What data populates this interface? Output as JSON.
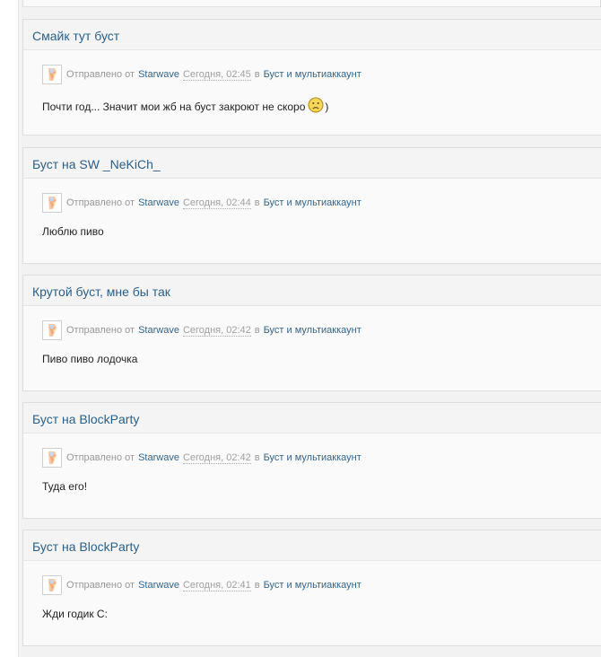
{
  "posts": [
    {
      "title": "Смайк тут буст",
      "sent_label": "Отправлено от",
      "author": "Starwave",
      "date": "Сегодня, 02:45",
      "in_label": "в",
      "forum": "Буст и мультиаккаунт",
      "body": "Почти год... Значит мои жб на буст закроют не скоро",
      "smiley_icon": "sad-smiley-icon",
      "body_after": ")"
    },
    {
      "title": "Буст на SW _NeKiCh_",
      "sent_label": "Отправлено от",
      "author": "Starwave",
      "date": "Сегодня, 02:44",
      "in_label": "в",
      "forum": "Буст и мультиаккаунт",
      "body": "Люблю пиво"
    },
    {
      "title": "Крутой буст, мне бы так",
      "sent_label": "Отправлено от",
      "author": "Starwave",
      "date": "Сегодня, 02:42",
      "in_label": "в",
      "forum": "Буст и мультиаккаунт",
      "body": "Пиво пиво лодочка"
    },
    {
      "title": "Буст на BlockParty",
      "sent_label": "Отправлено от",
      "author": "Starwave",
      "date": "Сегодня, 02:42",
      "in_label": "в",
      "forum": "Буст и мультиаккаунт",
      "body": "Туда его!"
    },
    {
      "title": "Буст на BlockParty",
      "sent_label": "Отправлено от",
      "author": "Starwave",
      "date": "Сегодня, 02:41",
      "in_label": "в",
      "forum": "Буст и мультиаккаунт",
      "body": "Жди годик С:"
    }
  ],
  "colors": {
    "link": "#2c5f87",
    "meta_gray": "#999999",
    "body_text": "#222222",
    "card_bg": "#fafafa",
    "page_bg": "#f2f2f2"
  },
  "icons": {
    "avatar": "user-avatar-icon"
  }
}
